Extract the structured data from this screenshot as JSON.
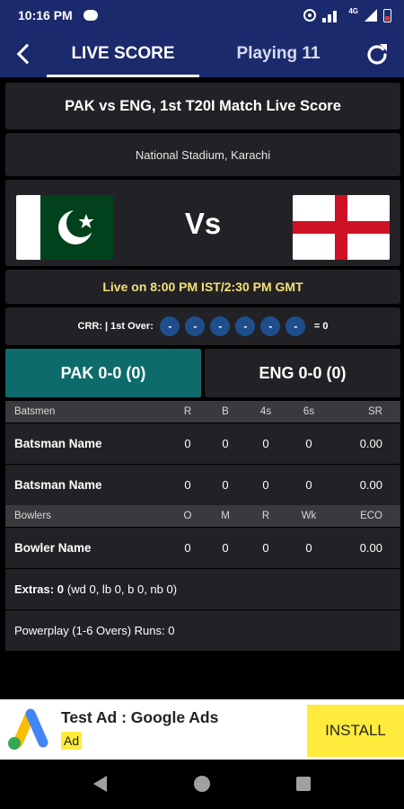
{
  "status_bar": {
    "time": "10:16 PM",
    "network": "4G"
  },
  "app_bar": {
    "tabs": [
      "LIVE SCORE",
      "Playing 11"
    ]
  },
  "match": {
    "title": "PAK vs ENG, 1st T20I Match Live Score",
    "venue": "National Stadium, Karachi",
    "vs_label": "Vs",
    "live_time": "Live on 8:00 PM IST/2:30 PM GMT",
    "crr_label": "CRR:",
    "over_label": "| 1st Over:",
    "balls": [
      "-",
      "-",
      "-",
      "-",
      "-",
      "-"
    ],
    "over_total": "= 0"
  },
  "teams": {
    "home_score": "PAK 0-0 (0)",
    "away_score": "ENG 0-0 (0)"
  },
  "batting": {
    "headers": [
      "Batsmen",
      "R",
      "B",
      "4s",
      "6s",
      "SR"
    ],
    "rows": [
      [
        "Batsman Name",
        "0",
        "0",
        "0",
        "0",
        "0.00"
      ],
      [
        "Batsman Name",
        "0",
        "0",
        "0",
        "0",
        "0.00"
      ]
    ]
  },
  "bowling": {
    "headers": [
      "Bowlers",
      "O",
      "M",
      "R",
      "Wk",
      "ECO"
    ],
    "rows": [
      [
        "Bowler Name",
        "0",
        "0",
        "0",
        "0",
        "0.00"
      ]
    ]
  },
  "extras": {
    "label": "Extras: 0",
    "detail": "(wd 0, lb 0, b 0, nb 0)"
  },
  "powerplay": "Powerplay (1-6 Overs) Runs: 0",
  "ad": {
    "title": "Test Ad : Google Ads",
    "badge": "Ad",
    "cta": "INSTALL"
  },
  "colors": {
    "app_bar": "#1a2a6c",
    "pak_team": "#0e6b6b",
    "pak_green": "#01411c",
    "eng_red": "#ce1124",
    "ad_yellow": "#ffeb3b",
    "ball_blue": "#1e4f8c"
  }
}
